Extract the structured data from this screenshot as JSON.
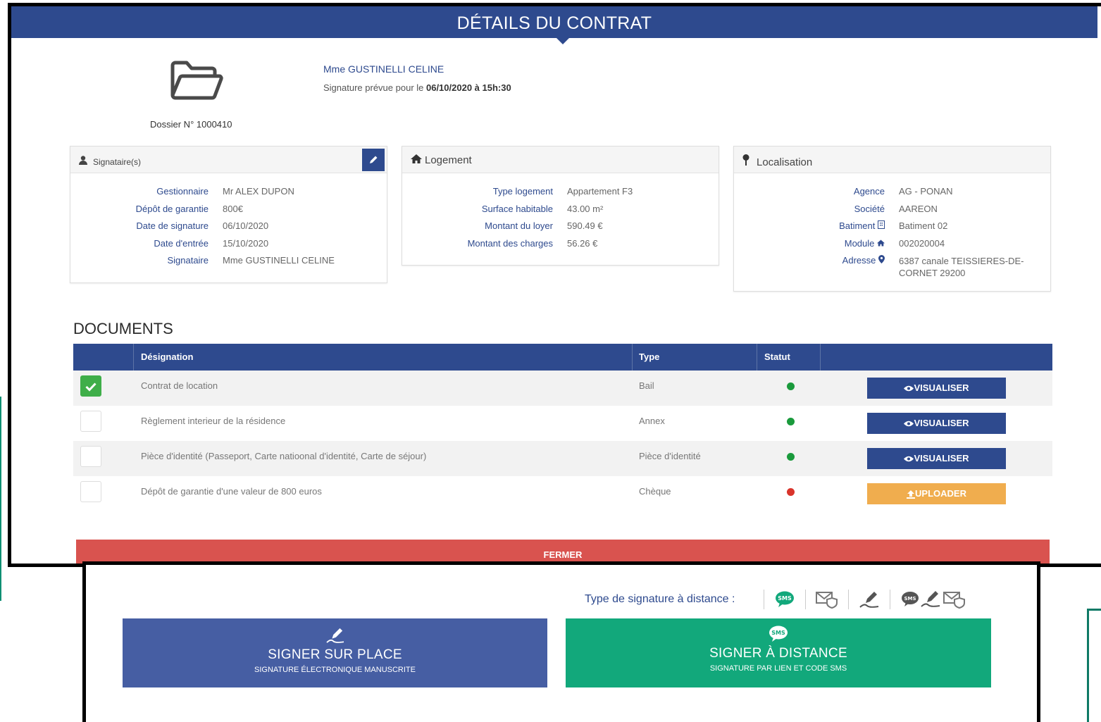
{
  "header": {
    "title": "DÉTAILS DU CONTRAT"
  },
  "summary": {
    "dossier": "Dossier N° 1000410",
    "client_name": "Mme GUSTINELLI CELINE",
    "signature_planned_prefix": "Signature prévue pour le ",
    "signature_planned_value": "06/10/2020 à 15h:30"
  },
  "signataires": {
    "title": "Signataire(s)",
    "rows": [
      {
        "key": "Gestionnaire",
        "value": "Mr ALEX DUPON"
      },
      {
        "key": "Dépôt de garantie",
        "value": "800€"
      },
      {
        "key": "Date de signature",
        "value": "06/10/2020"
      },
      {
        "key": "Date d'entrée",
        "value": "15/10/2020"
      },
      {
        "key": "Signataire",
        "value": "Mme GUSTINELLI CELINE"
      }
    ]
  },
  "logement": {
    "title": "Logement",
    "rows": [
      {
        "key": "Type logement",
        "value": "Appartement F3"
      },
      {
        "key": "Surface habitable",
        "value": "43.00 m²"
      },
      {
        "key": "Montant du loyer",
        "value": "590.49 €"
      },
      {
        "key": "Montant des charges",
        "value": "56.26 €"
      }
    ]
  },
  "localisation": {
    "title": "Localisation",
    "rows": [
      {
        "key": "Agence",
        "value": "AG - PONAN"
      },
      {
        "key": "Société",
        "value": "AAREON"
      },
      {
        "key": "Batiment",
        "value": "Batiment 02"
      },
      {
        "key": "Module",
        "value": "002020004"
      },
      {
        "key": "Adresse",
        "value": "6387 canale TEISSIERES-DE-CORNET 29200"
      }
    ]
  },
  "documents": {
    "title": "DOCUMENTS",
    "columns": [
      "Désignation",
      "Type",
      "Statut"
    ],
    "rows": [
      {
        "designation": "Contrat de location",
        "type": "Bail",
        "status": "ok",
        "checked": true,
        "action": "VISUALISER"
      },
      {
        "designation": "Règlement interieur de la résidence",
        "type": "Annex",
        "status": "ok",
        "checked": false,
        "action": "VISUALISER"
      },
      {
        "designation": "Pièce d'identité (Passeport, Carte natioonal d'identité, Carte de séjour)",
        "type": "Pièce d'identité",
        "status": "ok",
        "checked": false,
        "action": "VISUALISER"
      },
      {
        "designation": "Dépôt de garantie d'une valeur de 800 euros",
        "type": "Chèque",
        "status": "missing",
        "checked": false,
        "action": "UPLOADER"
      }
    ],
    "close_label": "FERMER"
  },
  "signature": {
    "type_label": "Type de signature à distance :",
    "onsite": {
      "title": "SIGNER SUR PLACE",
      "subtitle": "SIGNATURE ÉLECTRONIQUE MANUSCRITE"
    },
    "remote": {
      "title": "SIGNER À DISTANCE",
      "subtitle": "SIGNATURE PAR LIEN ET CODE SMS"
    },
    "sms_icon_text": "SMS"
  },
  "colors": {
    "primary": "#2e4a8e",
    "success": "#3fae49",
    "danger": "#d9534f",
    "warning": "#f0ad4e",
    "remote_green": "#12a87b",
    "onsite_blue": "#465ea3"
  },
  "icons": [
    "folder-icon",
    "user-icon",
    "pencil-icon",
    "home-icon",
    "map-pin-icon",
    "building-icon",
    "map-marker-icon",
    "eye-icon",
    "upload-icon",
    "check-icon",
    "sms-icon",
    "email-shield-icon",
    "signature-pen-icon"
  ]
}
